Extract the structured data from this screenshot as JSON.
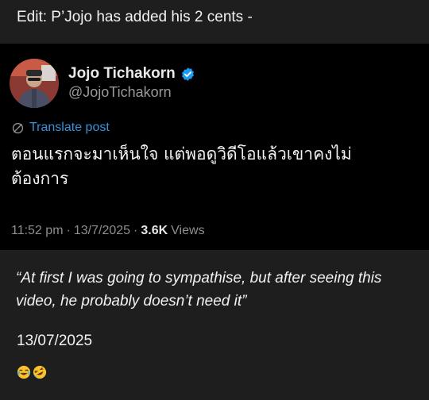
{
  "header": {
    "edit_note": "Edit: P’Jojo has added his 2 cents -"
  },
  "tweet": {
    "display_name": "Jojo Tichakorn",
    "handle": "@JojoTichakorn",
    "verified_icon": "verified-badge-icon",
    "translate_label": "Translate post",
    "translate_icon": "translate-globe-icon",
    "text": "ตอนแรกจะมาเห็นใจ แต่พอดูวิดีโอแล้วเขาคงไม่ต้องการ",
    "time": "11:52 pm",
    "date": "13/7/2025",
    "views_count": "3.6K",
    "views_label": "Views",
    "accent_color": "#1d9bf0"
  },
  "caption": {
    "translation": "“At first I was going to sympathise, but after seeing this video, he probably doesn’t need it”",
    "date": "13/07/2025",
    "emojis": [
      "face-with-tears-of-joy",
      "rolling-on-floor-laughing"
    ]
  }
}
